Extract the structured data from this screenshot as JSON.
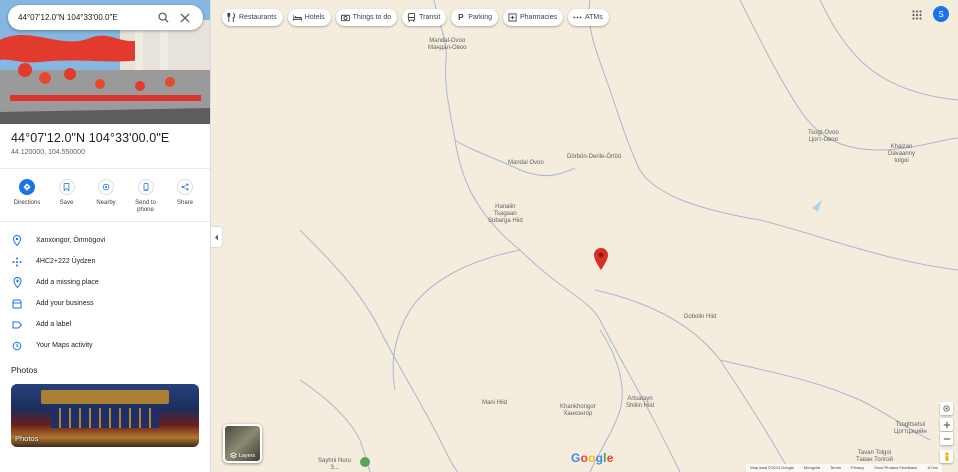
{
  "search": {
    "value": "44°07'12.0\"N 104°33'00.0\"E"
  },
  "place": {
    "title": "44°07'12.0\"N 104°33'00.0\"E",
    "coords": "44.120000, 104.550000"
  },
  "actions": [
    {
      "label": "Directions",
      "icon": "directions-icon"
    },
    {
      "label": "Save",
      "icon": "bookmark-icon"
    },
    {
      "label": "Nearby",
      "icon": "nearby-icon"
    },
    {
      "label": "Send to phone",
      "icon": "phone-icon"
    },
    {
      "label": "Share",
      "icon": "share-icon"
    }
  ],
  "details": [
    {
      "label": "Xanxongor, Ömnögovi",
      "icon": "location-pin-icon"
    },
    {
      "label": "4HC2+222 Üydzen",
      "icon": "plus-code-icon"
    },
    {
      "label": "Add a missing place",
      "icon": "add-place-icon"
    },
    {
      "label": "Add your business",
      "icon": "business-icon"
    },
    {
      "label": "Add a label",
      "icon": "label-icon"
    },
    {
      "label": "Your Maps activity",
      "icon": "history-icon"
    }
  ],
  "photos": {
    "heading": "Photos",
    "card_label": "Photos"
  },
  "chips": [
    {
      "label": "Restaurants",
      "icon": "restaurant-icon"
    },
    {
      "label": "Hotels",
      "icon": "hotel-icon"
    },
    {
      "label": "Things to do",
      "icon": "camera-icon"
    },
    {
      "label": "Transit",
      "icon": "transit-icon"
    },
    {
      "label": "Parking",
      "icon": "parking-icon"
    },
    {
      "label": "Pharmacies",
      "icon": "pharmacy-icon"
    },
    {
      "label": "ATMs",
      "icon": "more-icon"
    }
  ],
  "account": {
    "initial": "S"
  },
  "layers": {
    "label": "Layers"
  },
  "map_labels": {
    "mandal_ovoo_top": "Mandal-Ovoo\nМандал-Овоо",
    "tsogt_ovoo": "Tsogt-Ovoo\nЦогт-Овоо",
    "khaizan": "Khaizan\nDavaanny\ntolgoi",
    "mandal_ovoo_mid": "Mandal Ovoo",
    "dorvon": "Dörbön-Derile-Örtöö",
    "hanaiin": "Hanaiin\nTsagaan\nSubarga Hiid",
    "doboiin": "Doboiin Hiid",
    "artsatyn": "Artsatayn\nShiliin Hiid",
    "mani": "Mani Hiid",
    "khankhongor": "Khankhongor\nХанхонгор",
    "tsogttsetsii": "Tsogttsetsii\nЦогтцэцийн",
    "tavan": "Tavan Tolgoi\nТаван Толгой",
    "sayhni": "Sayhni Nuru\nЗ..."
  },
  "google_logo": "Google",
  "footer": [
    "Map data ©2024 Google",
    "Mongolia",
    "Terms",
    "Privacy",
    "Send Product Feedback",
    "10 km"
  ],
  "colors": {
    "map_bg": "#f4ecdd",
    "road": "#a8b7cf",
    "pin": "#d93025",
    "accent": "#1a73e8"
  }
}
